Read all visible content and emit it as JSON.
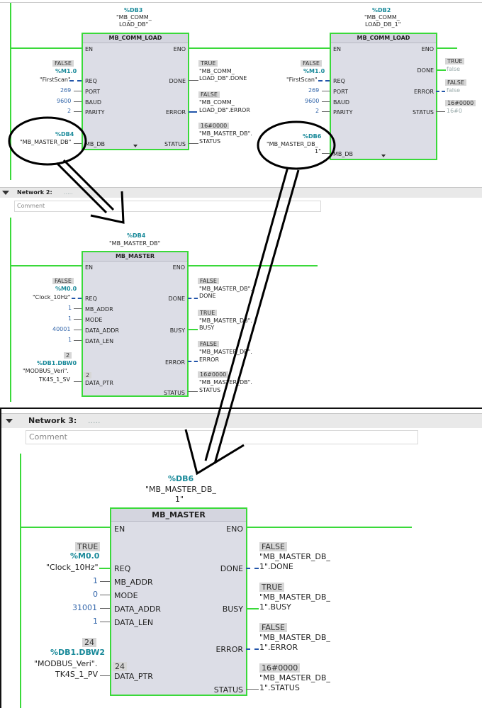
{
  "network1": {
    "block1": {
      "db": "%DB3",
      "db_name_l1": "\"MB_COMM_",
      "db_name_l2": "LOAD_DB\"",
      "title": "MB_COMM_LOAD",
      "in_pins": [
        "EN",
        "REQ",
        "PORT",
        "BAUD",
        "PARITY",
        "MB_DB"
      ],
      "out_pins": [
        "ENO",
        "DONE",
        "ERROR",
        "STATUS"
      ],
      "req_flag": "FALSE",
      "req_addr": "%M1.0",
      "req_tag": "\"FirstScan\"",
      "port": "269",
      "baud": "9600",
      "parity": "2",
      "mbdb_addr": "%DB4",
      "mbdb_tag": "\"MB_MASTER_DB\"",
      "done_flag": "TRUE",
      "done_l1": "\"MB_COMM_",
      "done_l2": "LOAD_DB\".DONE",
      "error_flag": "FALSE",
      "error_l1": "\"MB_COMM_",
      "error_l2": "LOAD_DB\".ERROR",
      "status_flag": "16#0000",
      "status_l1": "\"MB_MASTER_DB\".",
      "status_l2": "STATUS"
    },
    "block2": {
      "db": "%DB2",
      "db_name_l1": "\"MB_COMM_",
      "db_name_l2": "LOAD_DB_1\"",
      "title": "MB_COMM_LOAD",
      "in_pins": [
        "EN",
        "REQ",
        "PORT",
        "BAUD",
        "PARITY",
        "MB_DB"
      ],
      "out_pins": [
        "ENO",
        "DONE",
        "ERROR",
        "STATUS"
      ],
      "req_flag": "FALSE",
      "req_addr": "%M1.0",
      "req_tag": "\"FirstScan\"",
      "port": "269",
      "baud": "9600",
      "parity": "2",
      "mbdb_addr": "%DB6",
      "mbdb_tag_l1": "\"MB_MASTER_DB_",
      "mbdb_tag_l2": "1\"",
      "done_flag": "TRUE",
      "done_val": "false",
      "error_flag": "FALSE",
      "error_val": "false",
      "status_flag": "16#0000",
      "status_val": "16#0"
    }
  },
  "network2": {
    "label": "Network 2:",
    "dots": ".....",
    "comment": "Comment",
    "block": {
      "db": "%DB4",
      "db_name": "\"MB_MASTER_DB\"",
      "title": "MB_MASTER",
      "in_pins": [
        "EN",
        "REQ",
        "MB_ADDR",
        "MODE",
        "DATA_ADDR",
        "DATA_LEN",
        "DATA_PTR"
      ],
      "out_pins": [
        "ENO",
        "DONE",
        "BUSY",
        "ERROR",
        "STATUS"
      ],
      "req_flag": "FALSE",
      "req_addr": "%M0.0",
      "req_tag": "\"Clock_10Hz\"",
      "mb_addr": "1",
      "mode": "1",
      "data_addr": "40001",
      "data_len": "1",
      "ptr_flag": "2",
      "ptr_addr": "%DB1.DBW0",
      "ptr_tag_l1": "\"MODBUS_Veri\".",
      "ptr_tag_l2": "TK4S_1_SV",
      "ptr_inner": "2",
      "done_flag": "FALSE",
      "done_l1": "\"MB_MASTER_DB\".",
      "done_l2": "DONE",
      "busy_flag": "TRUE",
      "busy_l1": "\"MB_MASTER_DB\".",
      "busy_l2": "BUSY",
      "error_flag": "FALSE",
      "error_l1": "\"MB_MASTER_DB\".",
      "error_l2": "ERROR",
      "status_flag": "16#0000",
      "status_l1": "\"MB_MASTER_DB\".",
      "status_l2": "STATUS"
    }
  },
  "network3": {
    "label": "Network 3:",
    "dots": ".....",
    "comment": "Comment",
    "block": {
      "db": "%DB6",
      "db_name_l1": "\"MB_MASTER_DB_",
      "db_name_l2": "1\"",
      "title": "MB_MASTER",
      "in_pins": [
        "EN",
        "REQ",
        "MB_ADDR",
        "MODE",
        "DATA_ADDR",
        "DATA_LEN",
        "DATA_PTR"
      ],
      "out_pins": [
        "ENO",
        "DONE",
        "BUSY",
        "ERROR",
        "STATUS"
      ],
      "req_flag": "TRUE",
      "req_addr": "%M0.0",
      "req_tag": "\"Clock_10Hz\"",
      "mb_addr": "1",
      "mode": "0",
      "data_addr": "31001",
      "data_len": "1",
      "ptr_flag": "24",
      "ptr_addr": "%DB1.DBW2",
      "ptr_tag_l1": "\"MODBUS_Veri\".",
      "ptr_tag_l2": "TK4S_1_PV",
      "ptr_inner": "24",
      "done_flag": "FALSE",
      "done_l1": "\"MB_MASTER_DB_",
      "done_l2": "1\".DONE",
      "busy_flag": "TRUE",
      "busy_l1": "\"MB_MASTER_DB_",
      "busy_l2": "1\".BUSY",
      "error_flag": "FALSE",
      "error_l1": "\"MB_MASTER_DB_",
      "error_l2": "1\".ERROR",
      "status_flag": "16#0000",
      "status_l1": "\"MB_MASTER_DB_",
      "status_l2": "1\".STATUS"
    }
  }
}
